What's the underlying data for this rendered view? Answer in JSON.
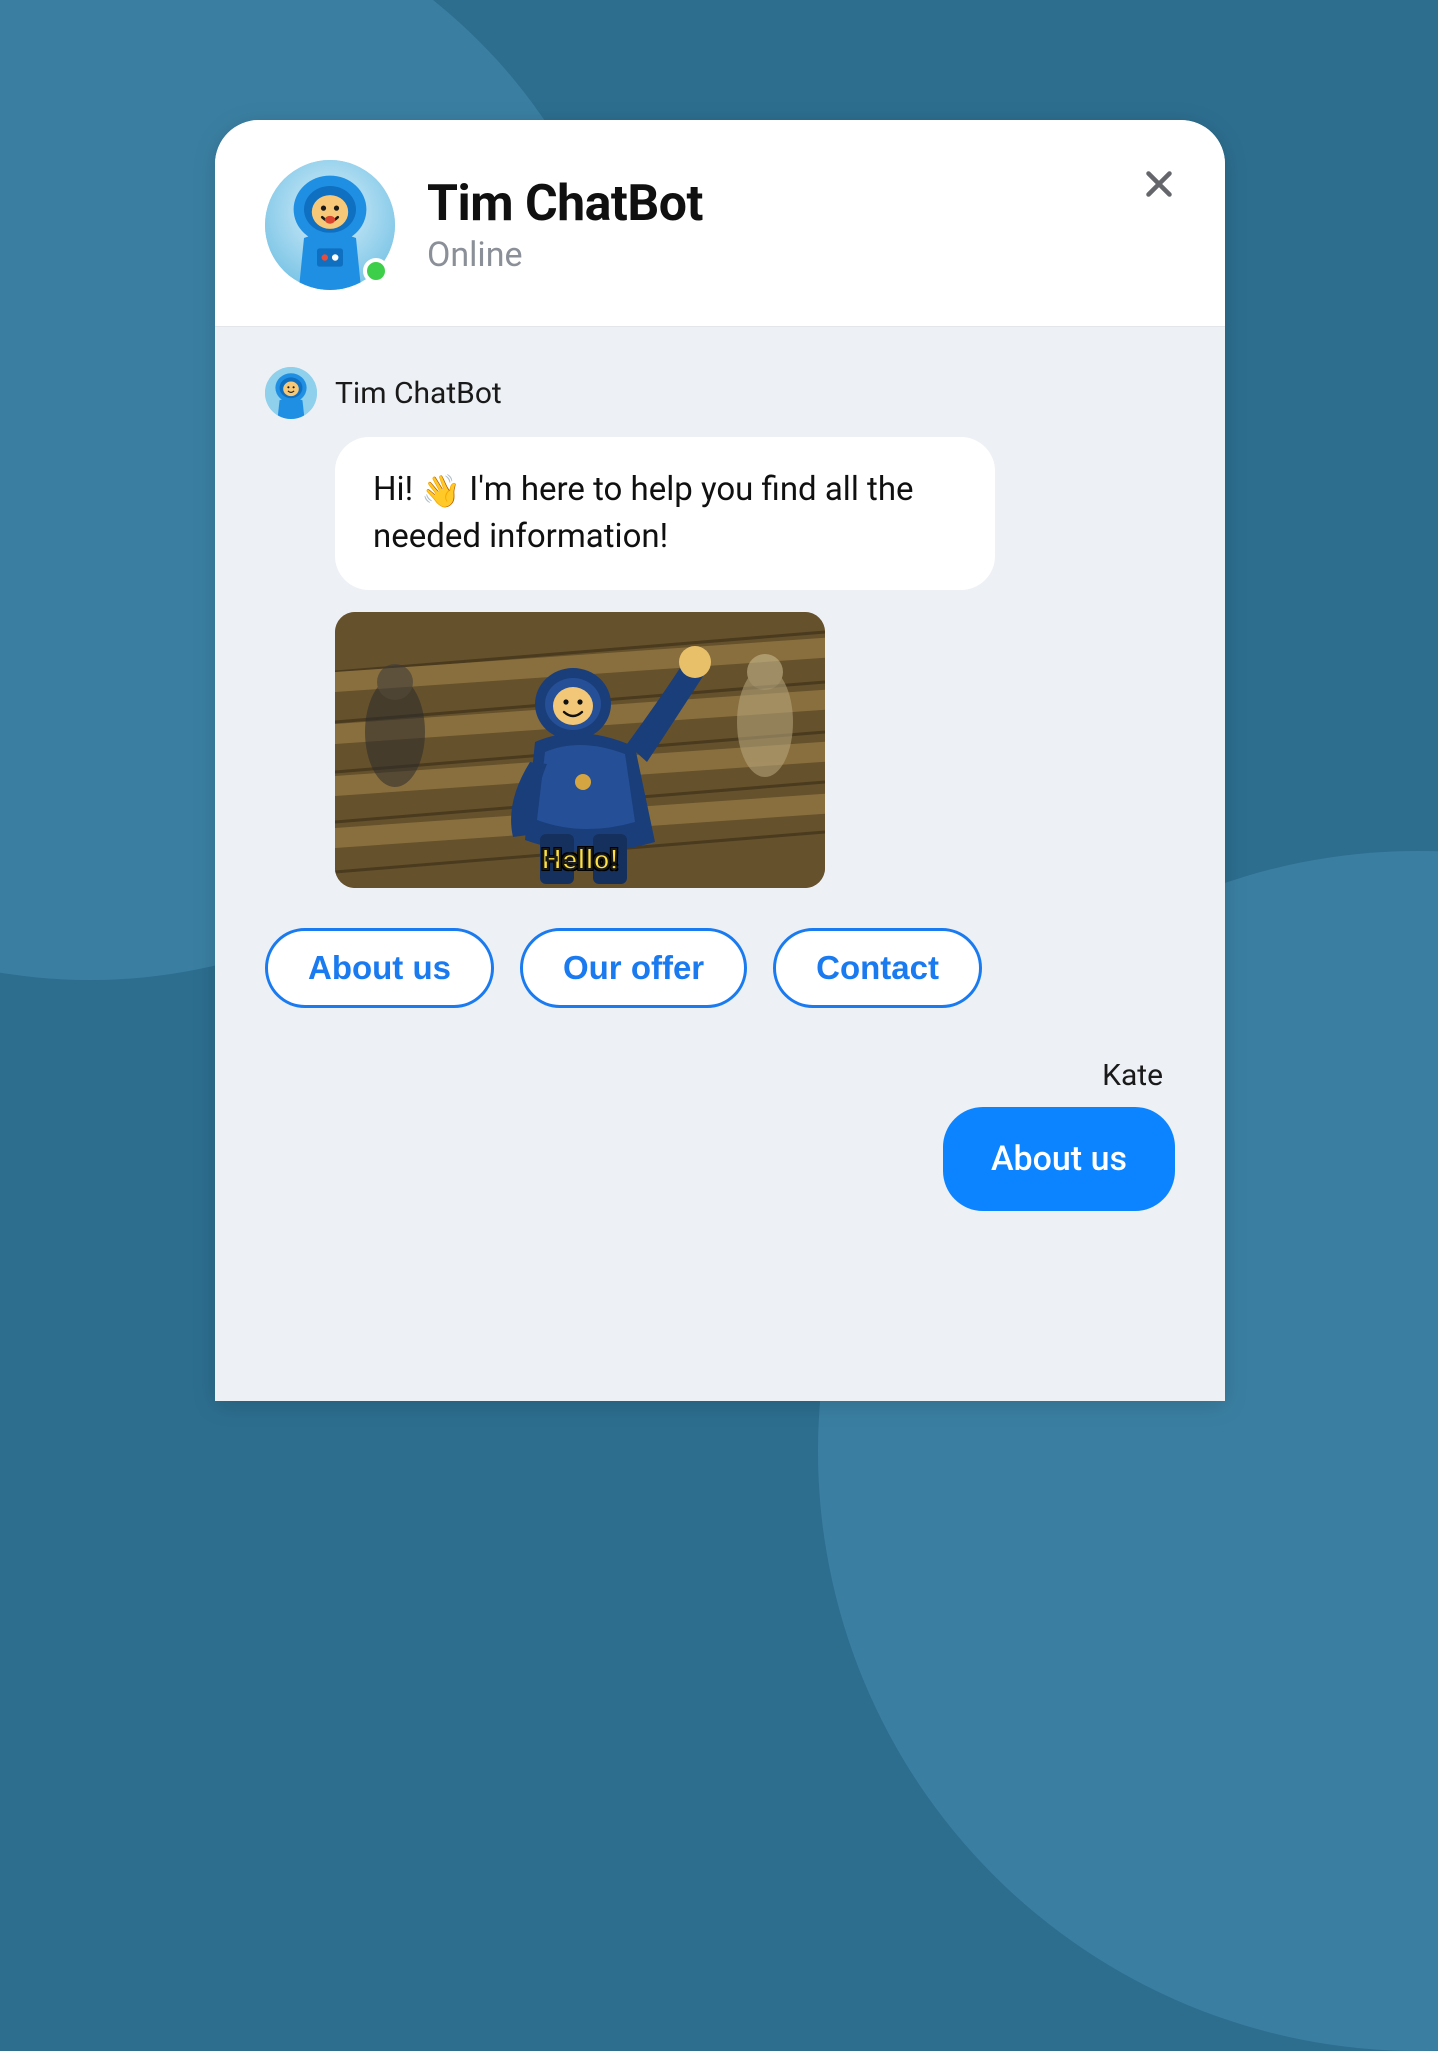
{
  "header": {
    "bot_name": "Tim ChatBot",
    "status_text": "Online",
    "status": "online"
  },
  "messages": [
    {
      "from": "bot",
      "sender_label": "Tim ChatBot",
      "text_before_emoji": "Hi! ",
      "emoji": "👋",
      "text_after_emoji": " I'm here to help you find all the needed information!",
      "gif_caption": "Hello!"
    }
  ],
  "quick_replies": [
    {
      "label": "About us"
    },
    {
      "label": "Our offer"
    },
    {
      "label": "Contact"
    }
  ],
  "user_reply": {
    "sender_label": "Kate",
    "text": "About us"
  },
  "colors": {
    "accent": "#1a7af0",
    "user_bubble": "#0c84ff",
    "online": "#3ecf4a"
  }
}
